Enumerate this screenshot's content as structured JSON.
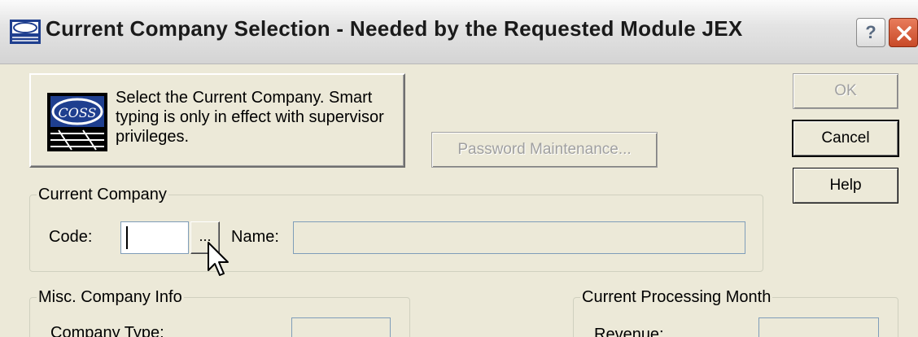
{
  "window": {
    "title": "Current Company Selection - Needed by the Requested Module JEX",
    "help_glyph": "?",
    "accent_color": "#ece9d8"
  },
  "info_panel": {
    "logo_text": "COSS",
    "message": "Select the Current Company. Smart typing is only in effect with supervisor privileges."
  },
  "buttons": {
    "ok_label": "OK",
    "cancel_label": "Cancel",
    "help_label": "Help",
    "password_label": "Password Maintenance...",
    "browse_label": "..."
  },
  "current_company": {
    "legend": "Current Company",
    "code_label": "Code:",
    "code_value": "",
    "name_label": "Name:",
    "name_value": ""
  },
  "misc_info": {
    "legend": "Misc. Company Info",
    "company_type_label": "Company Type:",
    "company_type_value": ""
  },
  "processing_month": {
    "legend": "Current Processing Month",
    "revenue_label": "Revenue:",
    "revenue_value": ""
  }
}
